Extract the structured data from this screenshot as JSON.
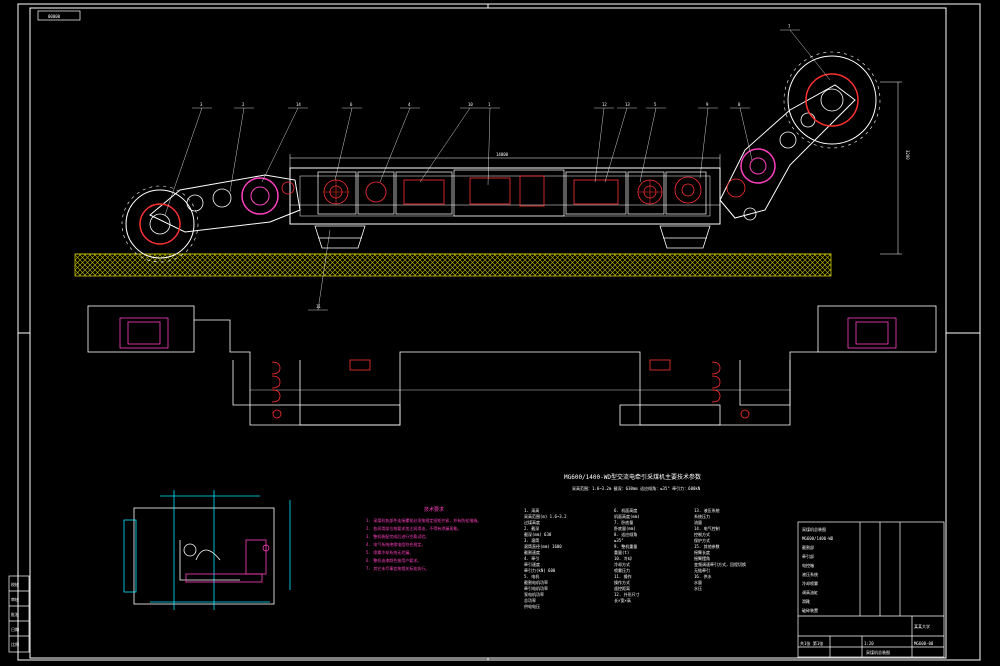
{
  "drawing": {
    "sheet_tag": "00000",
    "main_title": "MG600/1400-WD型交流电牵引采煤机主要技术参数",
    "subtitle": "采高范围：1.6~3.2m  截深：630mm  适应倾角：≤35°  牵引力：600kN",
    "tech_requirements_title": "技术要求",
    "tech_requirements": [
      "1. 采煤机各部件连接螺栓必须按规定扭矩拧紧，并有防松措施。",
      "2. 各润滑部位按要求加注润滑油，不得有渗漏现象。",
      "3. 整机装配完成后进行空载试验。",
      "4. 电气系统绝缘电阻符合规定。",
      "5. 喷雾冷却系统无泄漏。",
      "6. 整机油漆颜色按用户要求。",
      "7. 其它未尽事宜按相关标准执行。"
    ],
    "params_col1": [
      "1. 采高",
      "   采高范围(m) 1.6~3.2",
      "   过煤高度",
      "2. 截深",
      "   截深(mm) 630",
      "3. 滚筒",
      "   滚筒直径(mm) 1600",
      "   截割速度",
      "4. 牵引",
      "   牵引速度",
      "   牵引力(kN) 600",
      "5. 电机",
      "   截割电机功率",
      "   牵引电机功率",
      "   泵电机功率",
      "   总功率",
      "   供电电压"
    ],
    "params_col2": [
      "6. 机面高度",
      "   机面高度(mm)",
      "7. 卧底量",
      "   卧底量(mm)",
      "8. 适应倾角",
      "   ≤35°",
      "9. 整机重量",
      "   重量(t)",
      "10. 冷却",
      "   冷却方式",
      "   喷雾压力",
      "11. 操作",
      "   操作方式",
      "   遥控距离",
      "12. 外形尺寸",
      "   长×宽×高"
    ],
    "params_col3": [
      "13. 液压系统",
      "   系统压力",
      "   流量",
      "14. 电气控制",
      "   控制方式",
      "   保护方式",
      "15. 其他参数",
      "   摇臂长度",
      "   摇臂摆角",
      "   变频调速牵引方式，回程切换",
      "   无链牵引",
      "16. 供水",
      "   水量",
      "   水压"
    ],
    "part_numbers": [
      "1",
      "2",
      "3",
      "4",
      "5",
      "6",
      "7",
      "8",
      "9",
      "10",
      "11",
      "12",
      "13",
      "14"
    ],
    "dim_height": "3200",
    "dim_length": "14800",
    "title_block": {
      "rows": [
        "采煤机总装图",
        "MG600/1400-WD",
        "截割部",
        "牵引部",
        "电控箱",
        "液压系统",
        "冷却喷雾",
        "调高油缸",
        "滑靴",
        "破碎装置"
      ],
      "company": "某某大学",
      "drawing_no": "MG600-00",
      "scale": "1:20",
      "sheet": "共1张 第1张",
      "name_bottom": "采煤机总装图"
    },
    "left_strip": [
      "校核",
      "审核",
      "批准",
      "日期",
      "比例"
    ]
  }
}
